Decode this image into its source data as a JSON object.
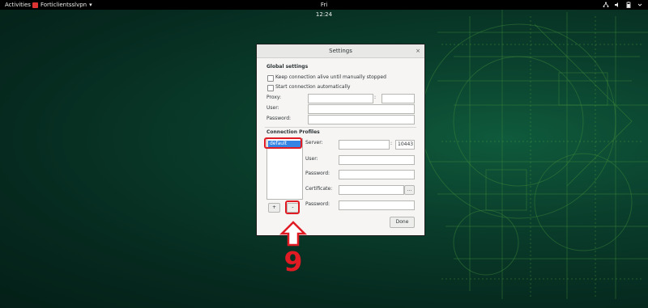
{
  "topbar": {
    "activities": "Activities",
    "app_name": "Forticlientsslvpn",
    "app_menu_arrow": "▾",
    "clock": "Fri 12:24",
    "tray_icons": [
      "network-icon",
      "volume-icon",
      "battery-icon",
      "power-menu-icon"
    ]
  },
  "dialog": {
    "title": "Settings",
    "close_glyph": "×",
    "global_heading": "Global settings",
    "keep_alive_label": "Keep connection alive until manually stopped",
    "start_auto_label": "Start connection automatically",
    "proxy_label": "Proxy:",
    "proxy_separator": ":",
    "user_label": "User:",
    "password_label": "Password:",
    "profiles_heading": "Connection Profiles",
    "profiles": [
      "default"
    ],
    "server_label": "Server:",
    "server_separator": ":",
    "server_port": "10443",
    "profile_user_label": "User:",
    "profile_password_label": "Password:",
    "certificate_label": "Certificate:",
    "browse_label": "...",
    "cert_password_label": "Password:",
    "add_label": "+",
    "remove_label": "-",
    "done_label": "Done"
  },
  "annotation": {
    "step_number": "9",
    "color": "#e01b24"
  }
}
